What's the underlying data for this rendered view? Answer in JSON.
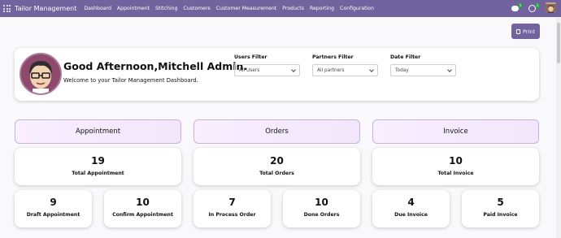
{
  "nav": {
    "brand": "Tailor Management",
    "menu": [
      "Dashboard",
      "Appointment",
      "Stitching",
      "Customers",
      "Customer Measurement",
      "Products",
      "Reporting",
      "Configuration"
    ],
    "chat_badge": "1",
    "activity_badge": "1"
  },
  "toolbar": {
    "print_label": "Print"
  },
  "welcome": {
    "greeting": "Good Afternoon,Mitchell Admin.",
    "subtitle": "Welcome to your Tailor Management Dashboard."
  },
  "filters": {
    "users": {
      "label": "Users Filter",
      "value": "All Users"
    },
    "partners": {
      "label": "Partners Filter",
      "value": "All partners"
    },
    "date": {
      "label": "Date Filter",
      "value": "Today"
    }
  },
  "sections": {
    "appointment": {
      "title": "Appointment",
      "total": {
        "value": "19",
        "label": "Total Appointment"
      },
      "cards": [
        {
          "value": "9",
          "label": "Draft Appointment"
        },
        {
          "value": "10",
          "label": "Confirm Appointment"
        }
      ]
    },
    "orders": {
      "title": "Orders",
      "total": {
        "value": "20",
        "label": "Total Orders"
      },
      "cards": [
        {
          "value": "7",
          "label": "In Process Order"
        },
        {
          "value": "10",
          "label": "Done Orders"
        }
      ]
    },
    "invoice": {
      "title": "Invoice",
      "total": {
        "value": "10",
        "label": "Total Invoice"
      },
      "cards": [
        {
          "value": "4",
          "label": "Due Invoice"
        },
        {
          "value": "5",
          "label": "Paid Invoice"
        }
      ]
    }
  },
  "colors": {
    "nav": "#71639e",
    "section_border": "#c8b0e0",
    "section_bg": "#f5ebfd"
  }
}
